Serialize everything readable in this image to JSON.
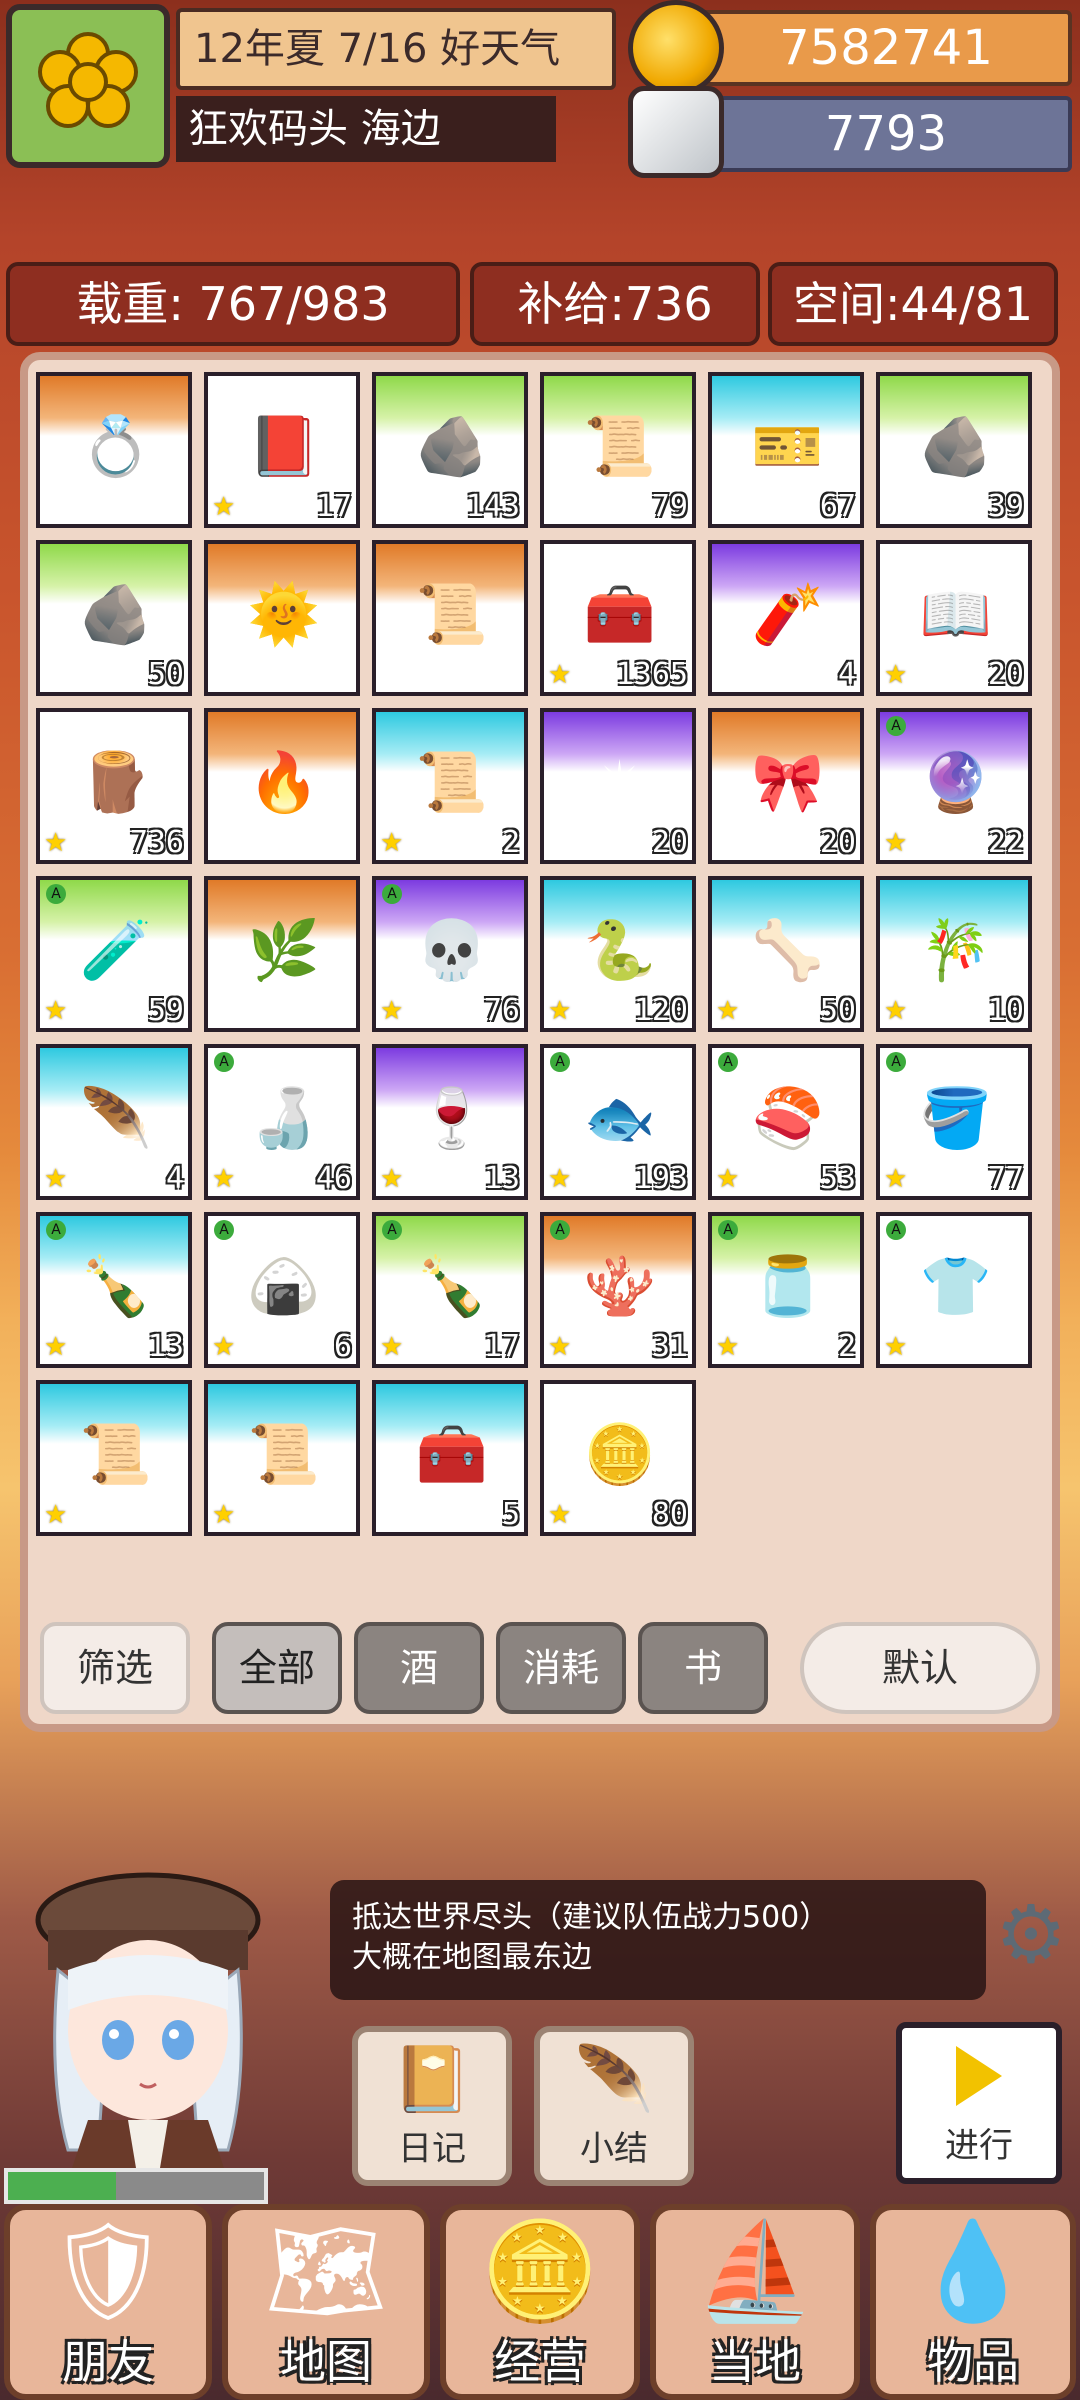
{
  "header": {
    "date": "12年夏 7/16 好天气",
    "location": "狂欢码头 海边",
    "gold": "7582741",
    "silver": "7793"
  },
  "stats": {
    "load": "载重: 767/983",
    "supply": "补给:736",
    "space": "空间:44/81"
  },
  "inventory": [
    {
      "bg": "orange",
      "icon": "ring-icon",
      "glyph": "💍",
      "count": "",
      "star": false,
      "a": false
    },
    {
      "bg": "white",
      "icon": "book-icon",
      "glyph": "📕",
      "count": "17",
      "star": true,
      "a": false
    },
    {
      "bg": "green",
      "icon": "rune-stone-icon",
      "glyph": "🪨",
      "count": "143",
      "star": false,
      "a": false
    },
    {
      "bg": "green",
      "icon": "paper-icon",
      "glyph": "📜",
      "count": "79",
      "star": false,
      "a": false
    },
    {
      "bg": "cyan",
      "icon": "ticket-icon",
      "glyph": "🎫",
      "count": "67",
      "star": false,
      "a": false
    },
    {
      "bg": "green",
      "icon": "rune-stone-icon",
      "glyph": "🪨",
      "count": "39",
      "star": false,
      "a": false
    },
    {
      "bg": "green",
      "icon": "rune-stone-icon",
      "glyph": "🪨",
      "count": "50",
      "star": false,
      "a": false
    },
    {
      "bg": "orange",
      "icon": "sun-medal-icon",
      "glyph": "🌞",
      "count": "",
      "star": false,
      "a": false
    },
    {
      "bg": "orange",
      "icon": "scroll-icon",
      "glyph": "📜",
      "count": "",
      "star": false,
      "a": false
    },
    {
      "bg": "white",
      "icon": "medkit-icon",
      "glyph": "🧰",
      "count": "1365",
      "star": true,
      "a": false
    },
    {
      "bg": "purple",
      "icon": "firecracker-icon",
      "glyph": "🧨",
      "count": "4",
      "star": false,
      "a": false
    },
    {
      "bg": "white",
      "icon": "holy-book-icon",
      "glyph": "📖",
      "count": "20",
      "star": true,
      "a": false
    },
    {
      "bg": "white",
      "icon": "log-icon",
      "glyph": "🪵",
      "count": "736",
      "star": true,
      "a": false
    },
    {
      "bg": "orange",
      "icon": "fire-ring-icon",
      "glyph": "🔥",
      "count": "",
      "star": false,
      "a": false
    },
    {
      "bg": "cyan",
      "icon": "fire-scroll-icon",
      "glyph": "📜",
      "count": "2",
      "star": true,
      "a": false
    },
    {
      "bg": "purple",
      "icon": "compass-icon",
      "glyph": "✴",
      "count": "20",
      "star": false,
      "a": false
    },
    {
      "bg": "orange",
      "icon": "ribbon-ring-icon",
      "glyph": "🎀",
      "count": "20",
      "star": false,
      "a": false
    },
    {
      "bg": "purple",
      "icon": "pearl-icon",
      "glyph": "🔮",
      "count": "22",
      "star": true,
      "a": true
    },
    {
      "bg": "green",
      "icon": "potion-icon",
      "glyph": "🧪",
      "count": "59",
      "star": true,
      "a": true
    },
    {
      "bg": "orange",
      "icon": "leaf-ring-icon",
      "glyph": "🌿",
      "count": "",
      "star": false,
      "a": false
    },
    {
      "bg": "purple",
      "icon": "skull-potion-icon",
      "glyph": "💀",
      "count": "76",
      "star": true,
      "a": true
    },
    {
      "bg": "cyan",
      "icon": "snake-icon",
      "glyph": "🐍",
      "count": "120",
      "star": true,
      "a": false
    },
    {
      "bg": "cyan",
      "icon": "bone-scroll-icon",
      "glyph": "🦴",
      "count": "50",
      "star": true,
      "a": false
    },
    {
      "bg": "cyan",
      "icon": "bamboo-icon",
      "glyph": "🎋",
      "count": "10",
      "star": true,
      "a": false
    },
    {
      "bg": "cyan",
      "icon": "feather-scroll-icon",
      "glyph": "🪶",
      "count": "4",
      "star": true,
      "a": false
    },
    {
      "bg": "white",
      "icon": "orange-bottle-icon",
      "glyph": "🍶",
      "count": "46",
      "star": true,
      "a": true
    },
    {
      "bg": "purple",
      "icon": "wine-bottle-icon",
      "glyph": "🍷",
      "count": "13",
      "star": true,
      "a": false
    },
    {
      "bg": "white",
      "icon": "fish-icon",
      "glyph": "🐟",
      "count": "193",
      "star": true,
      "a": true
    },
    {
      "bg": "white",
      "icon": "salmon-icon",
      "glyph": "🍣",
      "count": "53",
      "star": true,
      "a": true
    },
    {
      "bg": "white",
      "icon": "bucket-icon",
      "glyph": "🪣",
      "count": "77",
      "star": true,
      "a": true
    },
    {
      "bg": "cyan",
      "icon": "glass-bottle-icon",
      "glyph": "🍾",
      "count": "13",
      "star": true,
      "a": true
    },
    {
      "bg": "white",
      "icon": "rice-ball-icon",
      "glyph": "🍙",
      "count": "6",
      "star": true,
      "a": true
    },
    {
      "bg": "green",
      "icon": "sauce-bottle-icon",
      "glyph": "🍾",
      "count": "17",
      "star": true,
      "a": true
    },
    {
      "bg": "orange",
      "icon": "coral-icon",
      "glyph": "🪸",
      "count": "31",
      "star": true,
      "a": true
    },
    {
      "bg": "green",
      "icon": "jar-icon",
      "glyph": "🫙",
      "count": "2",
      "star": true,
      "a": true
    },
    {
      "bg": "white",
      "icon": "shirt-icon",
      "glyph": "👕",
      "count": "",
      "star": true,
      "a": true
    },
    {
      "bg": "cyan",
      "icon": "magic-scroll-icon",
      "glyph": "📜",
      "count": "",
      "star": true,
      "a": false
    },
    {
      "bg": "cyan",
      "icon": "spell-scroll-icon",
      "glyph": "📜",
      "count": "",
      "star": true,
      "a": false
    },
    {
      "bg": "cyan",
      "icon": "treasure-chest-icon",
      "glyph": "🧰",
      "count": "5",
      "star": false,
      "a": false
    },
    {
      "bg": "white",
      "icon": "gold-ore-icon",
      "glyph": "🪙",
      "count": "80",
      "star": true,
      "a": false
    }
  ],
  "filters": {
    "filter_label": "筛选",
    "tabs": [
      "全部",
      "酒",
      "消耗",
      "书"
    ],
    "sort_label": "默认"
  },
  "quest": {
    "line1": "抵达世界尽头（建议队伍战力500）",
    "line2": "大概在地图最东边"
  },
  "tools": {
    "diary": "日记",
    "summary": "小结",
    "go": "进行"
  },
  "nav": [
    "朋友",
    "地图",
    "经营",
    "当地",
    "物品"
  ],
  "player": {
    "hp_fraction": 0.42
  }
}
